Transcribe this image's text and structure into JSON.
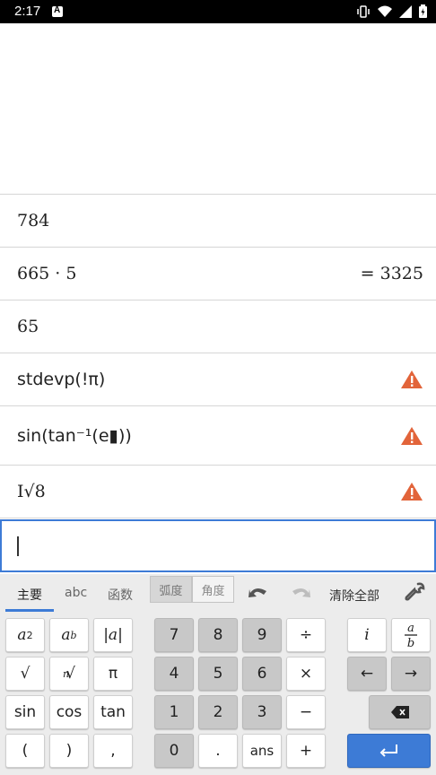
{
  "status": {
    "time": "2:17"
  },
  "expressions": [
    {
      "text": "784",
      "result": "",
      "warning": false
    },
    {
      "text": "665 · 5",
      "result": "= 3325",
      "warning": false
    },
    {
      "text": "65",
      "result": "",
      "warning": false
    },
    {
      "text": "stdevp(!π)",
      "result": "",
      "warning": true
    },
    {
      "text": "sin(tan⁻¹(e▮))",
      "result": "",
      "warning": true
    },
    {
      "text": "I√8",
      "result": "",
      "warning": true
    }
  ],
  "keyboard": {
    "tabs": [
      "主要",
      "abc",
      "函数"
    ],
    "angle_modes": [
      "弧度",
      "角度"
    ],
    "clear_all": "清除全部",
    "rows": [
      [
        "a²",
        "aᵇ",
        "|a|",
        "7",
        "8",
        "9",
        "÷",
        "i",
        "a/b"
      ],
      [
        "√",
        "ⁿ√",
        "π",
        "4",
        "5",
        "6",
        "×",
        "←",
        "→"
      ],
      [
        "sin",
        "cos",
        "tan",
        "1",
        "2",
        "3",
        "−",
        "⌫"
      ],
      [
        "(",
        ")",
        ",",
        "0",
        ".",
        "ans",
        "+",
        "↵"
      ]
    ]
  },
  "colors": {
    "accent": "#3d7bd6",
    "warning": "#e2643a"
  }
}
